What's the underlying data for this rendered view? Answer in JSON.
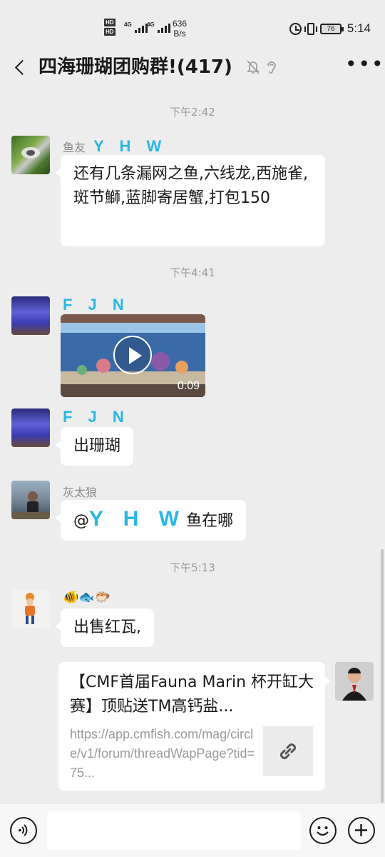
{
  "status_bar": {
    "hd1": "HD",
    "hd2": "HD",
    "net1": "4G",
    "net2": "4G",
    "speed_value": "636",
    "speed_unit": "B/s",
    "battery": "76",
    "time": "5:14"
  },
  "header": {
    "title": "四海珊瑚团购群!(417)"
  },
  "chat": {
    "timestamps": [
      "下午2:42",
      "下午4:41",
      "下午5:13"
    ],
    "messages": [
      {
        "sender": "鱼友",
        "sender_stylized": "Y H W",
        "text": "还有几条漏网之鱼,六线龙,西施雀,斑节鰤,蓝脚寄居蟹,打包150"
      },
      {
        "sender": "F J N",
        "video_duration": "0:09"
      },
      {
        "sender": "F J N",
        "text": "出珊瑚"
      },
      {
        "sender": "灰太狼",
        "text_prefix": "@",
        "text_mention": "Y H W",
        "text_suffix": "鱼在哪"
      },
      {
        "sender": "🐠🐟🐡",
        "text": "出售红瓦,"
      },
      {
        "link_title": "【CMF首届Fauna Marin 杯开缸大赛】顶贴送TM高钙盐...",
        "link_desc": "https://app.cmfish.com/mag/circle/v1/forum/threadWapPage?tid=75..."
      }
    ]
  },
  "input": {
    "placeholder": ""
  },
  "colors": {
    "background": "#ededed",
    "bubble": "#ffffff",
    "stylized_name": "#29b6e8",
    "timestamp": "#9a9a9a"
  }
}
